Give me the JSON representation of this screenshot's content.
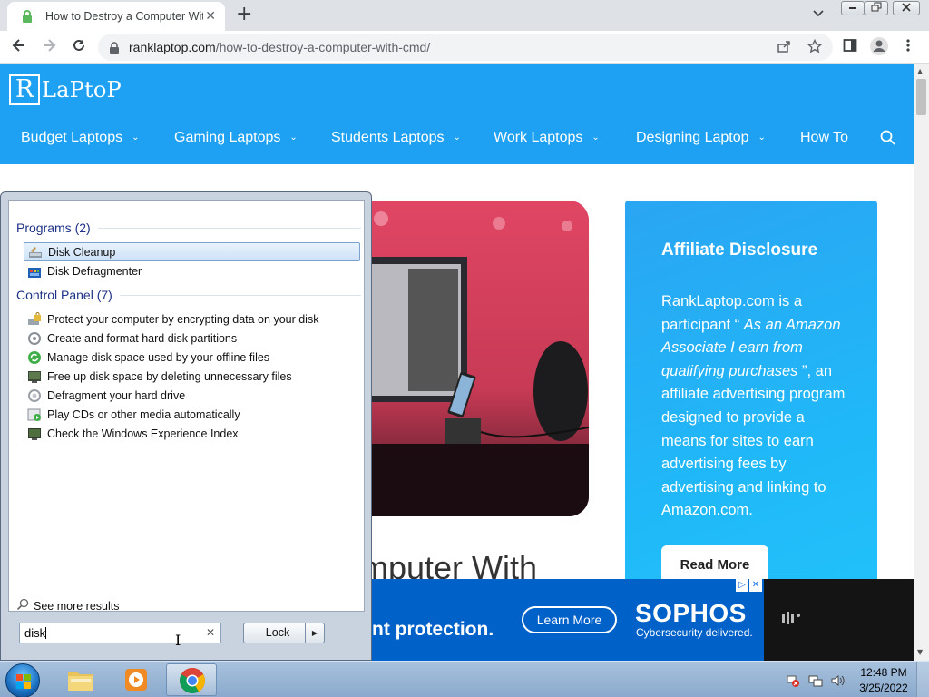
{
  "browser": {
    "tab_title": "How to Destroy a Computer With Cmd",
    "tab_close": "✕",
    "new_tab": "+",
    "url_host": "ranklaptop.com",
    "url_path": "/how-to-destroy-a-computer-with-cmd/",
    "tabs_menu": "⌄"
  },
  "site": {
    "logo_letter": "R",
    "logo_text": "LaPtoP",
    "nav": [
      {
        "label": "Budget Laptops"
      },
      {
        "label": "Gaming Laptops"
      },
      {
        "label": "Students Laptops"
      },
      {
        "label": "Work Laptops"
      },
      {
        "label": "Designing Laptop"
      },
      {
        "label": "How To"
      }
    ],
    "hero_title_fragment": "mputer With",
    "affiliate": {
      "title": "Affiliate Disclosure",
      "text_1": "RankLaptop.com is a participant “ ",
      "text_em": "As an Amazon Associate I earn from qualifying purchases",
      "text_2": " ”, an affiliate advertising program designed to provide a means for sites to earn advertising fees by advertising and linking to Amazon.com.",
      "button": "Read More"
    },
    "ad": {
      "left_text": "nt protection.",
      "cta": "Learn More",
      "brand": "SOPHOS",
      "tagline": "Cybersecurity delivered."
    }
  },
  "start_menu": {
    "programs_header": "Programs (2)",
    "programs": [
      {
        "label": "Disk Cleanup",
        "icon": "disk-cleanup-icon"
      },
      {
        "label": "Disk Defragmenter",
        "icon": "defragmenter-icon"
      }
    ],
    "control_panel_header": "Control Panel (7)",
    "control_panel": [
      {
        "label": "Protect your computer by encrypting data on your disk",
        "icon": "bitlocker-icon"
      },
      {
        "label": "Create and format hard disk partitions",
        "icon": "disk-management-icon"
      },
      {
        "label": "Manage disk space used by your offline files",
        "icon": "sync-center-icon"
      },
      {
        "label": "Free up disk space by deleting unnecessary files",
        "icon": "admin-tools-icon"
      },
      {
        "label": "Defragment your hard drive",
        "icon": "defrag-gear-icon"
      },
      {
        "label": "Play CDs or other media automatically",
        "icon": "autoplay-icon"
      },
      {
        "label": "Check the Windows Experience Index",
        "icon": "performance-icon"
      }
    ],
    "see_more": "See more results",
    "search_value": "disk",
    "lock_button": "Lock"
  },
  "taskbar": {
    "clock_time": "12:48 PM",
    "clock_date": "3/25/2022"
  }
}
